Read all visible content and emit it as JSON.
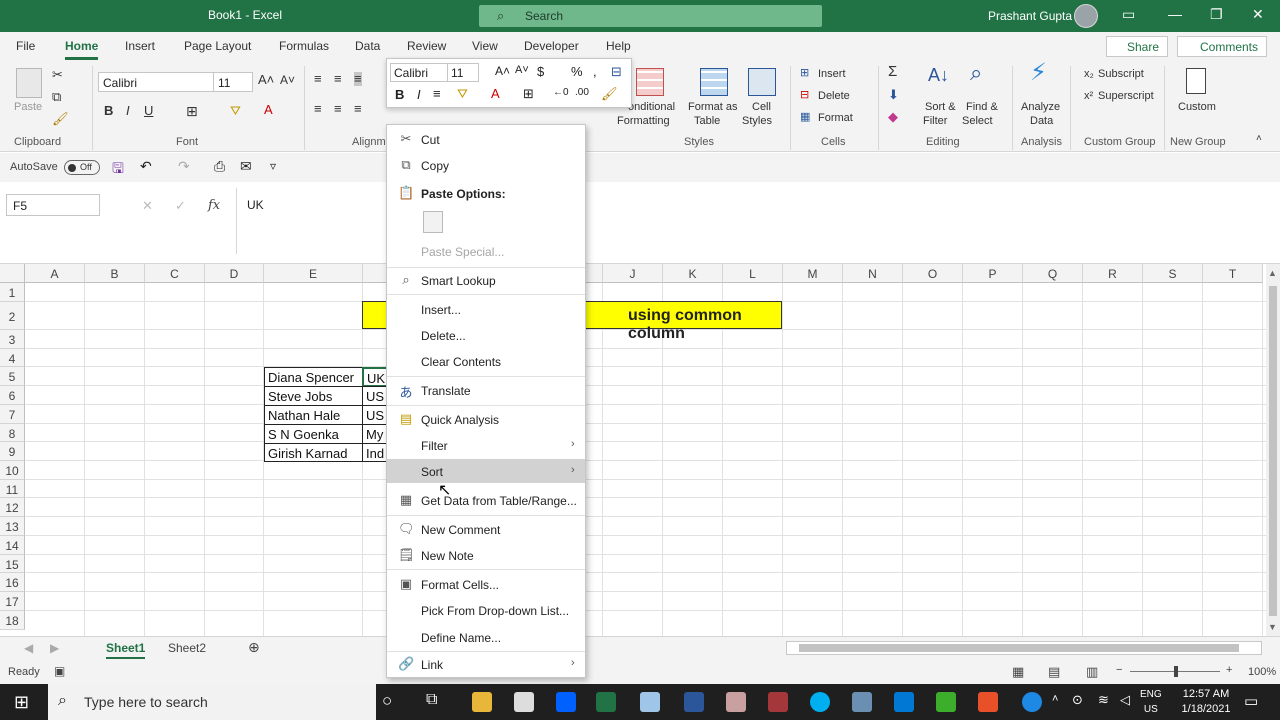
{
  "titlebar": {
    "title": "Book1  -  Excel",
    "search_placeholder": "Search",
    "user": "Prashant Gupta"
  },
  "tabs": [
    "File",
    "Home",
    "Insert",
    "Page Layout",
    "Formulas",
    "Data",
    "Review",
    "View",
    "Developer",
    "Help"
  ],
  "share_label": "Share",
  "comments_label": "Comments",
  "ribbon": {
    "paste": "Paste",
    "font_name": "Calibri",
    "font_size": "11",
    "groups": {
      "clipboard": "Clipboard",
      "font": "Font",
      "alignment": "Alignm",
      "styles": "Styles",
      "cells": "Cells",
      "editing": "Editing",
      "analysis": "Analysis",
      "custom_group": "Custom Group",
      "new_group": "New Group"
    },
    "conditional": "onditional",
    "formatting": "Formatting",
    "format_as": "Format as",
    "table": "Table",
    "cell": "Cell",
    "styles_btn": "Styles",
    "insert": "Insert",
    "delete": "Delete",
    "format": "Format",
    "sort": "Sort &",
    "filter": "Filter",
    "find": "Find &",
    "select": "Select",
    "analyze": "Analyze",
    "data": "Data",
    "subscript": "Subscript",
    "superscript": "Superscript",
    "custom": "Custom"
  },
  "qat": {
    "autosave": "AutoSave",
    "toggle": "Off"
  },
  "formula": {
    "namebox": "F5",
    "fx": "fx",
    "value": "UK"
  },
  "columns": [
    "A",
    "B",
    "C",
    "D",
    "E",
    "",
    "",
    "",
    "",
    "J",
    "K",
    "L",
    "M",
    "N",
    "O",
    "P",
    "Q",
    "R",
    "S",
    "T"
  ],
  "rows": [
    "1",
    "2",
    "3",
    "4",
    "5",
    "6",
    "7",
    "8",
    "9",
    "10",
    "11",
    "12",
    "13",
    "14",
    "15",
    "16",
    "17",
    "18"
  ],
  "banner_text": "using common column",
  "names": [
    "Diana Spencer",
    "Steve Jobs",
    "Nathan Hale",
    "S N Goenka",
    "Girish Karnad"
  ],
  "countries": [
    "UK",
    "US",
    "US",
    "My",
    "Ind"
  ],
  "sheets": [
    "Sheet1",
    "Sheet2"
  ],
  "status": {
    "ready": "Ready",
    "zoom": "100%"
  },
  "mini_toolbar": {
    "font": "Calibri",
    "size": "11"
  },
  "context_menu": {
    "cut": "Cut",
    "copy": "Copy",
    "paste_options": "Paste Options:",
    "paste_special": "Paste Special...",
    "smart_lookup": "Smart Lookup",
    "insert": "Insert...",
    "delete": "Delete...",
    "clear_contents": "Clear Contents",
    "translate": "Translate",
    "quick_analysis": "Quick Analysis",
    "filter": "Filter",
    "sort": "Sort",
    "get_data": "Get Data from Table/Range...",
    "new_comment": "New Comment",
    "new_note": "New Note",
    "format_cells": "Format Cells...",
    "pick_list": "Pick From Drop-down List...",
    "define_name": "Define Name...",
    "link": "Link"
  },
  "taskbar": {
    "search": "Type here to search",
    "lang1": "ENG",
    "lang2": "US",
    "time": "12:57 AM",
    "date": "1/18/2021"
  },
  "colors": {
    "excel_green": "#217346",
    "banner_yellow": "#ffff00",
    "menu_hover": "#d2d2d2"
  }
}
